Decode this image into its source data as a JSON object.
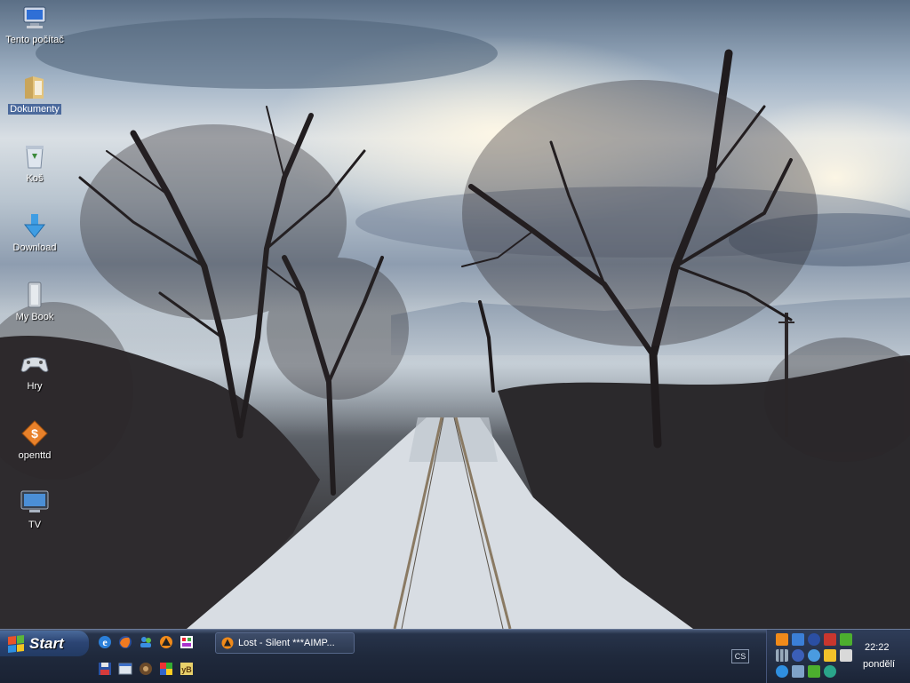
{
  "desktop": {
    "icons": [
      {
        "label": "Tento počítač",
        "icon": "my-computer-icon"
      },
      {
        "label": "Dokumenty",
        "icon": "documents-folder-icon"
      },
      {
        "label": "Koš",
        "icon": "recycle-bin-icon"
      },
      {
        "label": "Download",
        "icon": "download-arrow-icon"
      },
      {
        "label": "My Book",
        "icon": "external-drive-icon"
      },
      {
        "label": "Hry",
        "icon": "gamepad-icon"
      },
      {
        "label": "openttd",
        "icon": "openttd-icon"
      },
      {
        "label": "TV",
        "icon": "tv-monitor-icon"
      }
    ]
  },
  "taskbar": {
    "start_label": "Start",
    "quick_launch": [
      "ie-icon",
      "firefox-icon",
      "messenger-icon",
      "aimp-icon",
      "app-icon",
      "floppy-icon",
      "window-icon",
      "chrome-icon",
      "picasa-icon",
      "yb-icon"
    ],
    "tasks": [
      {
        "label": "Lost - Silent ***AIMP..."
      }
    ],
    "language": "CS",
    "clock": {
      "time": "22:22",
      "day": "pondělí"
    }
  },
  "colors": {
    "taskbar": "#1f293c",
    "start_button": "#2c4574",
    "tray": "#2f3d59"
  }
}
